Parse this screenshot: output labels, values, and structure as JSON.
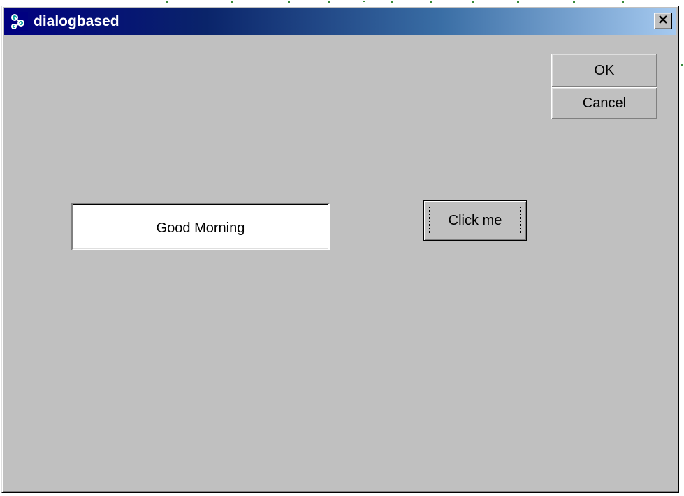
{
  "window": {
    "title": "dialogbased",
    "app_icon": "dialog-app-icon",
    "close_icon": "close-icon"
  },
  "buttons": {
    "ok_label": "OK",
    "cancel_label": "Cancel",
    "click_me_label": "Click me"
  },
  "edit": {
    "value": "Good Morning"
  },
  "colors": {
    "titlebar_start": "#000080",
    "titlebar_end": "#a6caf0",
    "face": "#c0c0c0"
  }
}
